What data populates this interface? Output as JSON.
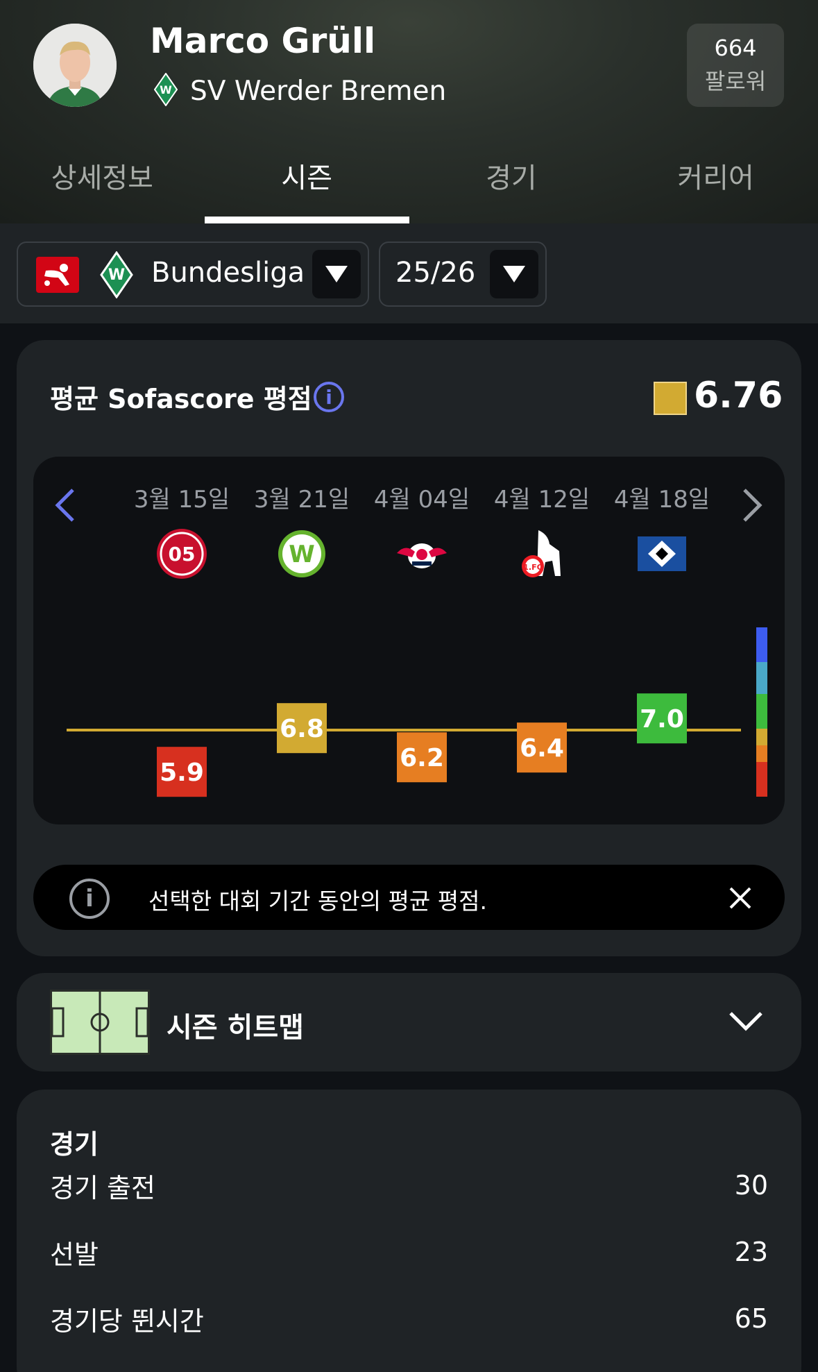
{
  "player": {
    "name": "Marco Grüll",
    "team": "SV Werder Bremen",
    "followers_count": "664",
    "followers_label": "팔로워"
  },
  "tabs": [
    {
      "label": "상세정보",
      "active": false
    },
    {
      "label": "시즌",
      "active": true
    },
    {
      "label": "경기",
      "active": false
    },
    {
      "label": "커리어",
      "active": false
    }
  ],
  "filters": {
    "league": "Bundesliga",
    "season": "25/26"
  },
  "rating": {
    "title": "평균 Sofascore 평점",
    "average": "6.76",
    "average_color": "#d2aa32",
    "notice": "선택한 대회 기간 동안의 평균 평점.",
    "matches": [
      {
        "date": "3월 15일",
        "opponent_icon": "mainz-05-crest",
        "rating": "5.9",
        "color": "#d7301f"
      },
      {
        "date": "3월 21일",
        "opponent_icon": "wolfsburg-crest",
        "rating": "6.8",
        "color": "#d2aa32"
      },
      {
        "date": "4월 04일",
        "opponent_icon": "rb-leipzig-crest",
        "rating": "6.2",
        "color": "#e67e22"
      },
      {
        "date": "4월 12일",
        "opponent_icon": "fc-koln-crest",
        "rating": "6.4",
        "color": "#e67e22"
      },
      {
        "date": "4월 18일",
        "opponent_icon": "hamburger-sv-crest",
        "rating": "7.0",
        "color": "#3dbb3d"
      }
    ],
    "scale_colors": [
      "#3d5cf0",
      "#4aa8c8",
      "#3dbb3d",
      "#d2aa32",
      "#e67e22",
      "#d7301f"
    ]
  },
  "heatmap": {
    "title": "시즌 히트맵"
  },
  "matches_section": {
    "title": "경기",
    "rows": [
      {
        "label": "경기 출전",
        "value": "30"
      },
      {
        "label": "선발",
        "value": "23"
      },
      {
        "label": "경기당 뛴시간",
        "value": "65"
      }
    ]
  }
}
